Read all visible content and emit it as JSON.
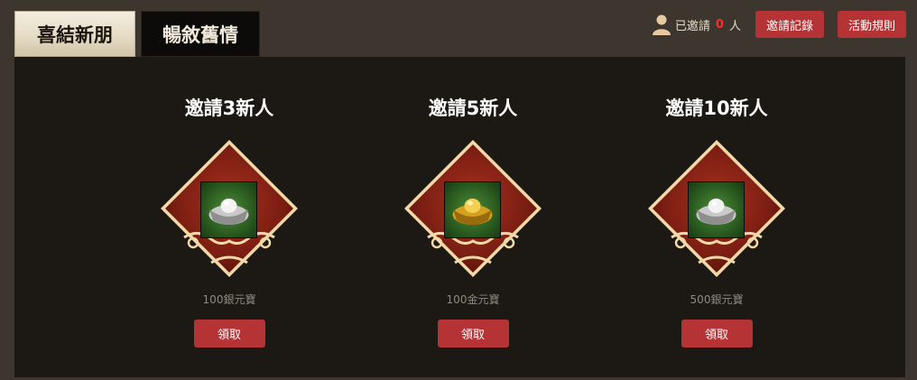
{
  "tabs": [
    {
      "label": "喜結新朋",
      "active": true
    },
    {
      "label": "暢敘舊情",
      "active": false
    }
  ],
  "header": {
    "invited_prefix": "已邀請",
    "invited_count": "0",
    "invited_suffix": "人",
    "record_button": "邀請記錄",
    "rules_button": "活動規則"
  },
  "rewards": [
    {
      "title": "邀請3新人",
      "item": "100銀元寶",
      "icon": "silver-ingot-icon",
      "claim": "領取"
    },
    {
      "title": "邀請5新人",
      "item": "100金元寶",
      "icon": "gold-ingot-icon",
      "claim": "領取"
    },
    {
      "title": "邀請10新人",
      "item": "500銀元寶",
      "icon": "silver-ingot-icon",
      "claim": "領取"
    }
  ],
  "colors": {
    "background": "#3d362e",
    "panel": "#1c1915",
    "button": "#b53335",
    "count": "#ff2b2b"
  }
}
